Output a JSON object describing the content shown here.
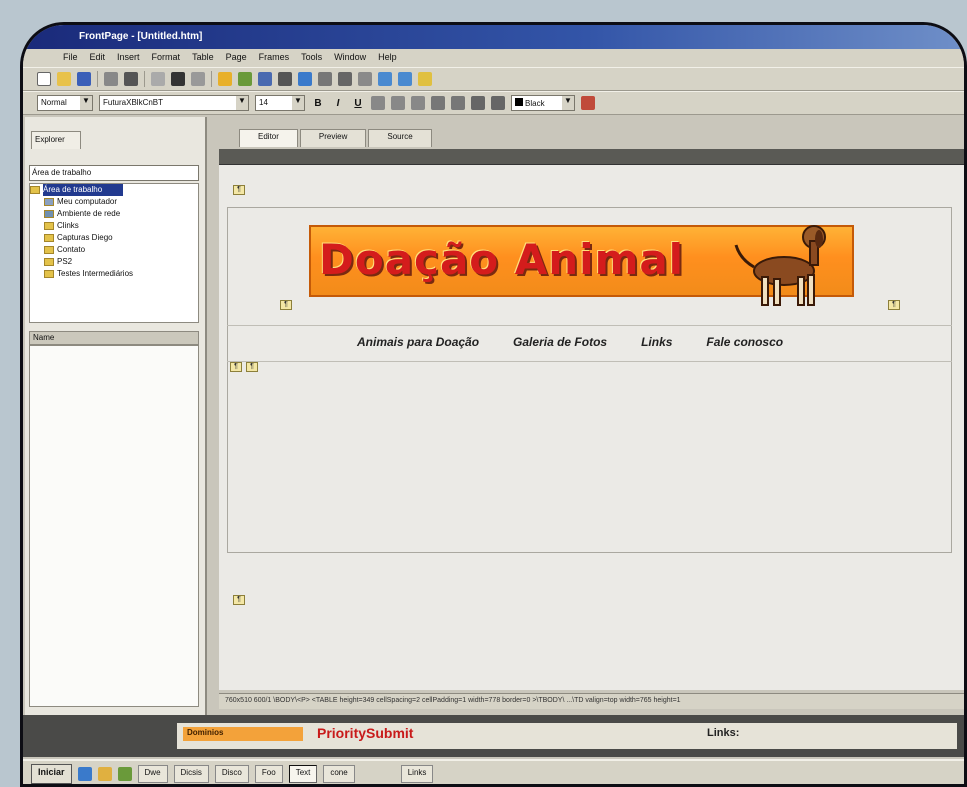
{
  "window": {
    "title": "FrontPage - [Untitled.htm]"
  },
  "menu": [
    "File",
    "Edit",
    "Insert",
    "Format",
    "Table",
    "Page",
    "Frames",
    "Tools",
    "Window",
    "Help"
  ],
  "formatting": {
    "style": "Normal",
    "font": "FuturaXBlkCnBT",
    "size": "14",
    "color": "Black",
    "bold": "B",
    "italic": "I",
    "underline": "U"
  },
  "sidebar": {
    "tab": "Explorer",
    "path": "Área de trabalho",
    "tree": [
      "Área de trabalho",
      "Meu computador",
      "Ambiente de rede",
      "Clinks",
      "Capturas Diego",
      "Contato",
      "PS2",
      "Testes Intermediários"
    ],
    "list_header": "Name"
  },
  "view_tabs": [
    "Editor",
    "Preview",
    "Source"
  ],
  "document": {
    "banner_title": "Doação Animal",
    "nav": [
      "Animais para Doação",
      "Galeria de Fotos",
      "Links",
      "Fale conosco"
    ]
  },
  "status_text": "760x510   600/1   \\BODY\\<P> <TABLE height=349 cellSpacing=2 cellPadding=1 width=778 border=0 >\\TBODY\\ ...\\TD valign=top width=765 height=1",
  "bottom_window": {
    "left_label": "Dominios",
    "mid_title": "PrioritySubmit",
    "right_label": "Links:"
  },
  "taskbar": {
    "start": "Iniciar",
    "items": [
      "Dwe",
      "Dicsis",
      "Disco",
      "Foo",
      "Text",
      "cone"
    ],
    "active": "Text",
    "right": "Links"
  },
  "colors": {
    "banner_orange": "#ff8f1e",
    "banner_text": "#d41c1c",
    "title_bar": "#1a2a7a"
  }
}
